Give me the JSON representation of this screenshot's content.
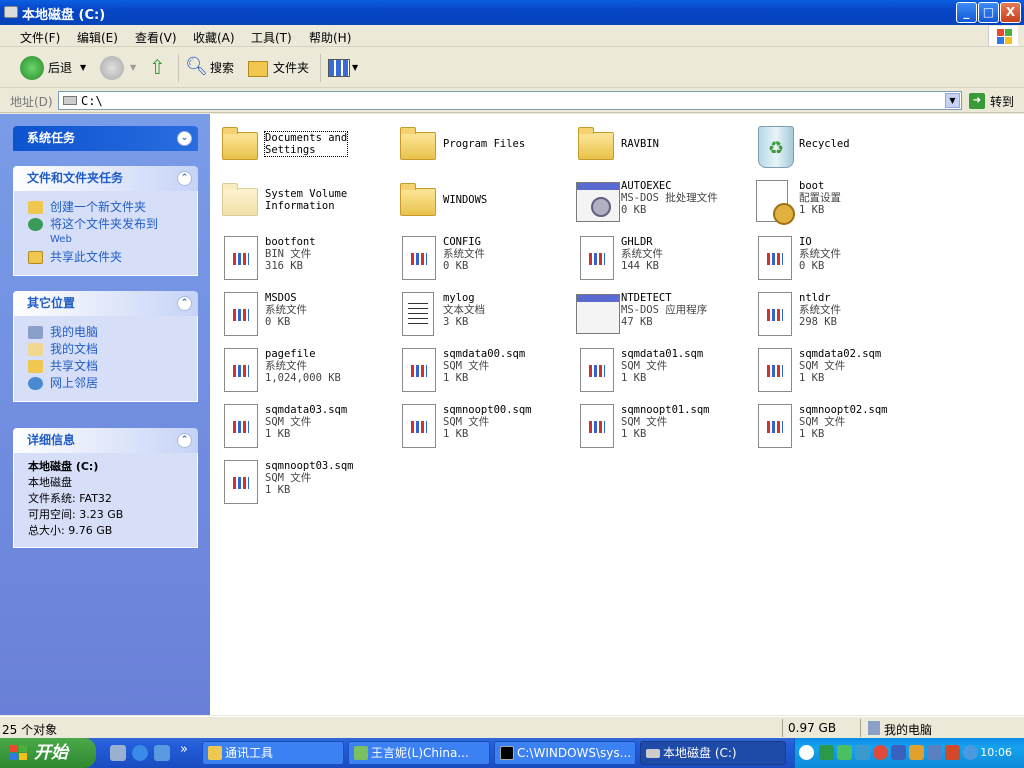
{
  "window": {
    "title": "本地磁盘 (C:)",
    "buttons": {
      "minimize": "_",
      "maximize": "□",
      "close": "X"
    }
  },
  "menu": [
    "文件(F)",
    "编辑(E)",
    "查看(V)",
    "收藏(A)",
    "工具(T)",
    "帮助(H)"
  ],
  "toolbar": {
    "back": "后退",
    "search": "搜索",
    "folders": "文件夹"
  },
  "address": {
    "label": "地址(D)",
    "value": "C:\\",
    "go": "转到"
  },
  "left_panel": {
    "system_tasks": {
      "title": "系统任务"
    },
    "file_tasks": {
      "title": "文件和文件夹任务",
      "items": [
        "创建一个新文件夹",
        "将这个文件夹发布到",
        "Web",
        "共享此文件夹"
      ]
    },
    "other_places": {
      "title": "其它位置",
      "items": [
        "我的电脑",
        "我的文档",
        "共享文档",
        "网上邻居"
      ]
    },
    "details": {
      "title": "详细信息",
      "name": "本地磁盘 (C:)",
      "type": "本地磁盘",
      "fs": "文件系统: FAT32",
      "free": "可用空间: 3.23 GB",
      "total": "总大小: 9.76 GB"
    }
  },
  "files": [
    {
      "name": "Documents and",
      "name2": "Settings",
      "icon": "folder-icon"
    },
    {
      "name": "Program Files",
      "icon": "folder-icon"
    },
    {
      "name": "RAVBIN",
      "icon": "folder-icon"
    },
    {
      "name": "Recycled",
      "icon": "recycle-bin-icon"
    },
    {
      "name": "System Volume",
      "name2": "Information",
      "icon": "hidden-folder-icon"
    },
    {
      "name": "WINDOWS",
      "icon": "folder-icon"
    },
    {
      "name": "AUTOEXEC",
      "type": "MS-DOS 批处理文件",
      "size": "0 KB",
      "icon": "batch-file-icon"
    },
    {
      "name": "boot",
      "type": "配置设置",
      "size": "1 KB",
      "icon": "config-file-icon"
    },
    {
      "name": "bootfont",
      "type": "BIN 文件",
      "size": "316 KB",
      "icon": "system-file-icon"
    },
    {
      "name": "CONFIG",
      "type": "系统文件",
      "size": "0 KB",
      "icon": "system-file-icon"
    },
    {
      "name": "GHLDR",
      "type": "系统文件",
      "size": "144 KB",
      "icon": "system-file-icon"
    },
    {
      "name": "IO",
      "type": "系统文件",
      "size": "0 KB",
      "icon": "system-file-icon"
    },
    {
      "name": "MSDOS",
      "type": "系统文件",
      "size": "0 KB",
      "icon": "system-file-icon"
    },
    {
      "name": "mylog",
      "type": "文本文档",
      "size": "3 KB",
      "icon": "text-file-icon"
    },
    {
      "name": "NTDETECT",
      "type": "MS-DOS 应用程序",
      "size": "47 KB",
      "icon": "application-icon"
    },
    {
      "name": "ntldr",
      "type": "系统文件",
      "size": "298 KB",
      "icon": "system-file-icon"
    },
    {
      "name": "pagefile",
      "type": "系统文件",
      "size": "1,024,000 KB",
      "icon": "system-file-icon"
    },
    {
      "name": "sqmdata00.sqm",
      "type": "SQM 文件",
      "size": "1 KB",
      "icon": "system-file-icon"
    },
    {
      "name": "sqmdata01.sqm",
      "type": "SQM 文件",
      "size": "1 KB",
      "icon": "system-file-icon"
    },
    {
      "name": "sqmdata02.sqm",
      "type": "SQM 文件",
      "size": "1 KB",
      "icon": "system-file-icon"
    },
    {
      "name": "sqmdata03.sqm",
      "type": "SQM 文件",
      "size": "1 KB",
      "icon": "system-file-icon"
    },
    {
      "name": "sqmnoopt00.sqm",
      "type": "SQM 文件",
      "size": "1 KB",
      "icon": "system-file-icon"
    },
    {
      "name": "sqmnoopt01.sqm",
      "type": "SQM 文件",
      "size": "1 KB",
      "icon": "system-file-icon"
    },
    {
      "name": "sqmnoopt02.sqm",
      "type": "SQM 文件",
      "size": "1 KB",
      "icon": "system-file-icon"
    },
    {
      "name": "sqmnoopt03.sqm",
      "type": "SQM 文件",
      "size": "1 KB",
      "icon": "system-file-icon"
    }
  ],
  "status": {
    "count": "25 个对象",
    "size": "0.97 GB",
    "location": "我的电脑"
  },
  "taskbar": {
    "start": "开始",
    "more": "»",
    "tasks": [
      "通讯工具",
      "王言妮(L)China...",
      "C:\\WINDOWS\\sys...",
      "本地磁盘 (C:)"
    ],
    "clock": "10:06"
  }
}
